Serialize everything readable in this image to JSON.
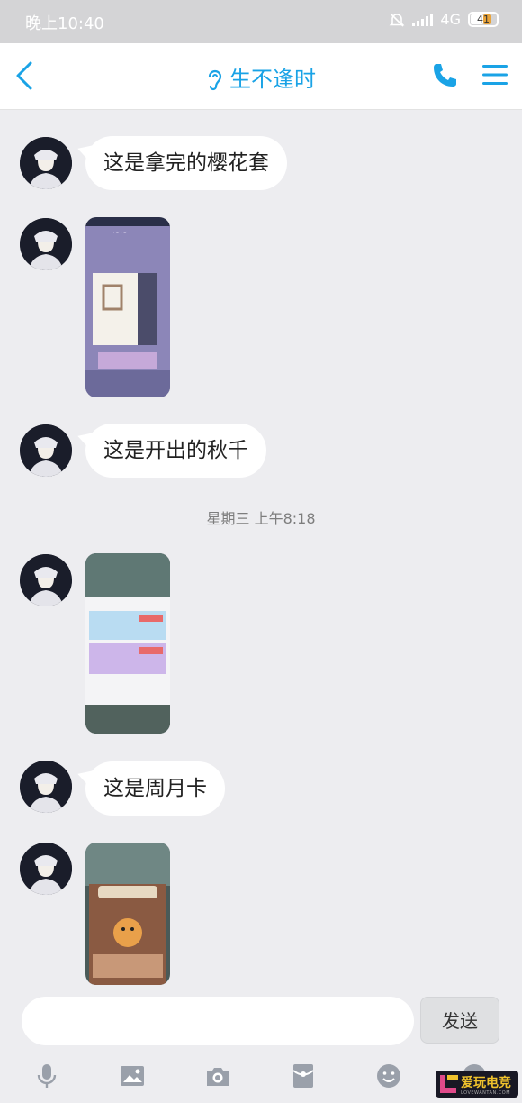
{
  "status_bar": {
    "time": "晚上10:40",
    "network": "4G",
    "battery": "41"
  },
  "nav": {
    "title": "生不逢时"
  },
  "messages": [
    {
      "type": "text",
      "text": "这是拿完的樱花套"
    },
    {
      "type": "image",
      "desc": "game-screenshot-1"
    },
    {
      "type": "text",
      "text": "这是开出的秋千"
    },
    {
      "type": "timestamp",
      "text": "星期三 上午8:18"
    },
    {
      "type": "image",
      "desc": "game-screenshot-2"
    },
    {
      "type": "text",
      "text": "这是周月卡"
    },
    {
      "type": "image",
      "desc": "game-screenshot-3"
    }
  ],
  "input": {
    "placeholder": "",
    "send_label": "发送"
  },
  "toolbar_icons": [
    "microphone-icon",
    "image-icon",
    "camera-icon",
    "red-packet-icon",
    "emoji-icon",
    "plus-icon"
  ],
  "watermark": {
    "text": "爱玩电竞",
    "sub": "LOVEWANTAN.COM"
  },
  "colors": {
    "accent": "#1aa3e6",
    "background": "#ededf0"
  }
}
